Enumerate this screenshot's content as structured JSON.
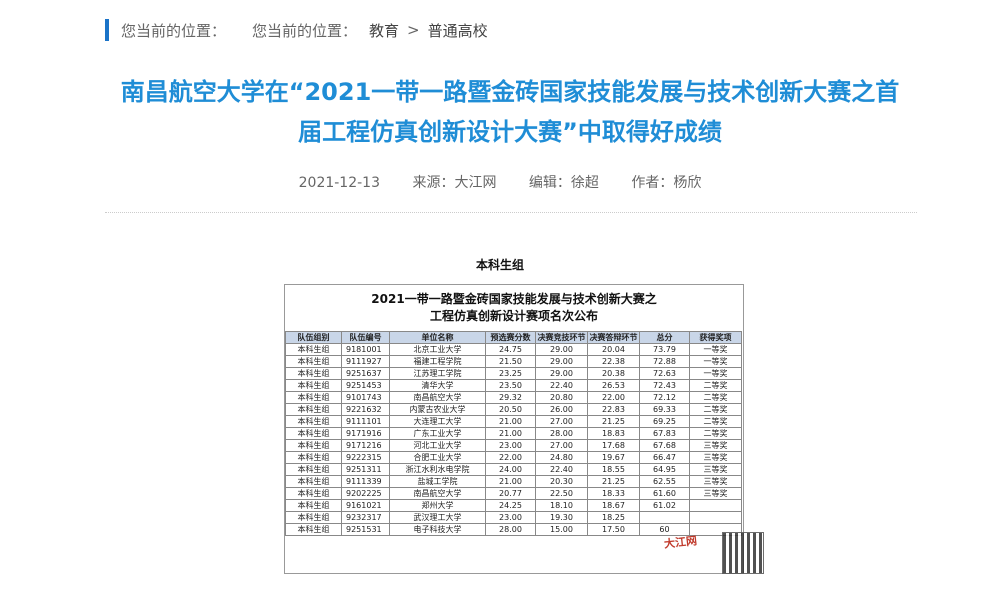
{
  "breadcrumb": {
    "label1": "您当前的位置：",
    "label2": "您当前的位置：",
    "items": [
      "教育",
      "普通高校"
    ],
    "separator": ">"
  },
  "article": {
    "title_line1": "南昌航空大学在“2021一带一路暨金砖国家技能发展与技术创新大赛之首",
    "title_line2": "届工程仿真创新设计大赛”中取得好成绩",
    "date": "2021-12-13",
    "source": "来源：大江网",
    "editor": "编辑：徐超",
    "author": "作者：杨欣"
  },
  "figure": {
    "caption": "本科生组",
    "table_title_line1": "2021一带一路暨金砖国家技能发展与技术创新大赛之",
    "table_title_line2": "工程仿真创新设计赛项名次公布",
    "headers": [
      "队伍组别",
      "队伍编号",
      "单位名称",
      "预选赛分数",
      "决赛竞技环节",
      "决赛答辩环节",
      "总分",
      "获得奖项"
    ],
    "rows": [
      [
        "本科生组",
        "9181001",
        "北京工业大学",
        "24.75",
        "29.00",
        "20.04",
        "73.79",
        "一等奖"
      ],
      [
        "本科生组",
        "9111927",
        "福建工程学院",
        "21.50",
        "29.00",
        "22.38",
        "72.88",
        "一等奖"
      ],
      [
        "本科生组",
        "9251637",
        "江苏理工学院",
        "23.25",
        "29.00",
        "20.38",
        "72.63",
        "一等奖"
      ],
      [
        "本科生组",
        "9251453",
        "清华大学",
        "23.50",
        "22.40",
        "26.53",
        "72.43",
        "二等奖"
      ],
      [
        "本科生组",
        "9101743",
        "南昌航空大学",
        "29.32",
        "20.80",
        "22.00",
        "72.12",
        "二等奖"
      ],
      [
        "本科生组",
        "9221632",
        "内蒙古农业大学",
        "20.50",
        "26.00",
        "22.83",
        "69.33",
        "二等奖"
      ],
      [
        "本科生组",
        "9111101",
        "大连理工大学",
        "21.00",
        "27.00",
        "21.25",
        "69.25",
        "二等奖"
      ],
      [
        "本科生组",
        "9171916",
        "广东工业大学",
        "21.00",
        "28.00",
        "18.83",
        "67.83",
        "二等奖"
      ],
      [
        "本科生组",
        "9171216",
        "河北工业大学",
        "23.00",
        "27.00",
        "17.68",
        "67.68",
        "三等奖"
      ],
      [
        "本科生组",
        "9222315",
        "合肥工业大学",
        "22.00",
        "24.80",
        "19.67",
        "66.47",
        "三等奖"
      ],
      [
        "本科生组",
        "9251311",
        "浙江水利水电学院",
        "24.00",
        "22.40",
        "18.55",
        "64.95",
        "三等奖"
      ],
      [
        "本科生组",
        "9111339",
        "盐城工学院",
        "21.00",
        "20.30",
        "21.25",
        "62.55",
        "三等奖"
      ],
      [
        "本科生组",
        "9202225",
        "南昌航空大学",
        "20.77",
        "22.50",
        "18.33",
        "61.60",
        "三等奖"
      ],
      [
        "本科生组",
        "9161021",
        "郑州大学",
        "24.25",
        "18.10",
        "18.67",
        "61.02",
        ""
      ],
      [
        "本科生组",
        "9232317",
        "武汉理工大学",
        "23.00",
        "19.30",
        "18.25",
        "",
        ""
      ],
      [
        "本科生组",
        "9251531",
        "电子科技大学",
        "28.00",
        "15.00",
        "17.50",
        "60",
        ""
      ]
    ],
    "watermark": "大江网"
  },
  "colors": {
    "title": "#1f8dd6",
    "accent_bar": "#1a73c8",
    "table_header_bg": "#c9d6e8"
  }
}
